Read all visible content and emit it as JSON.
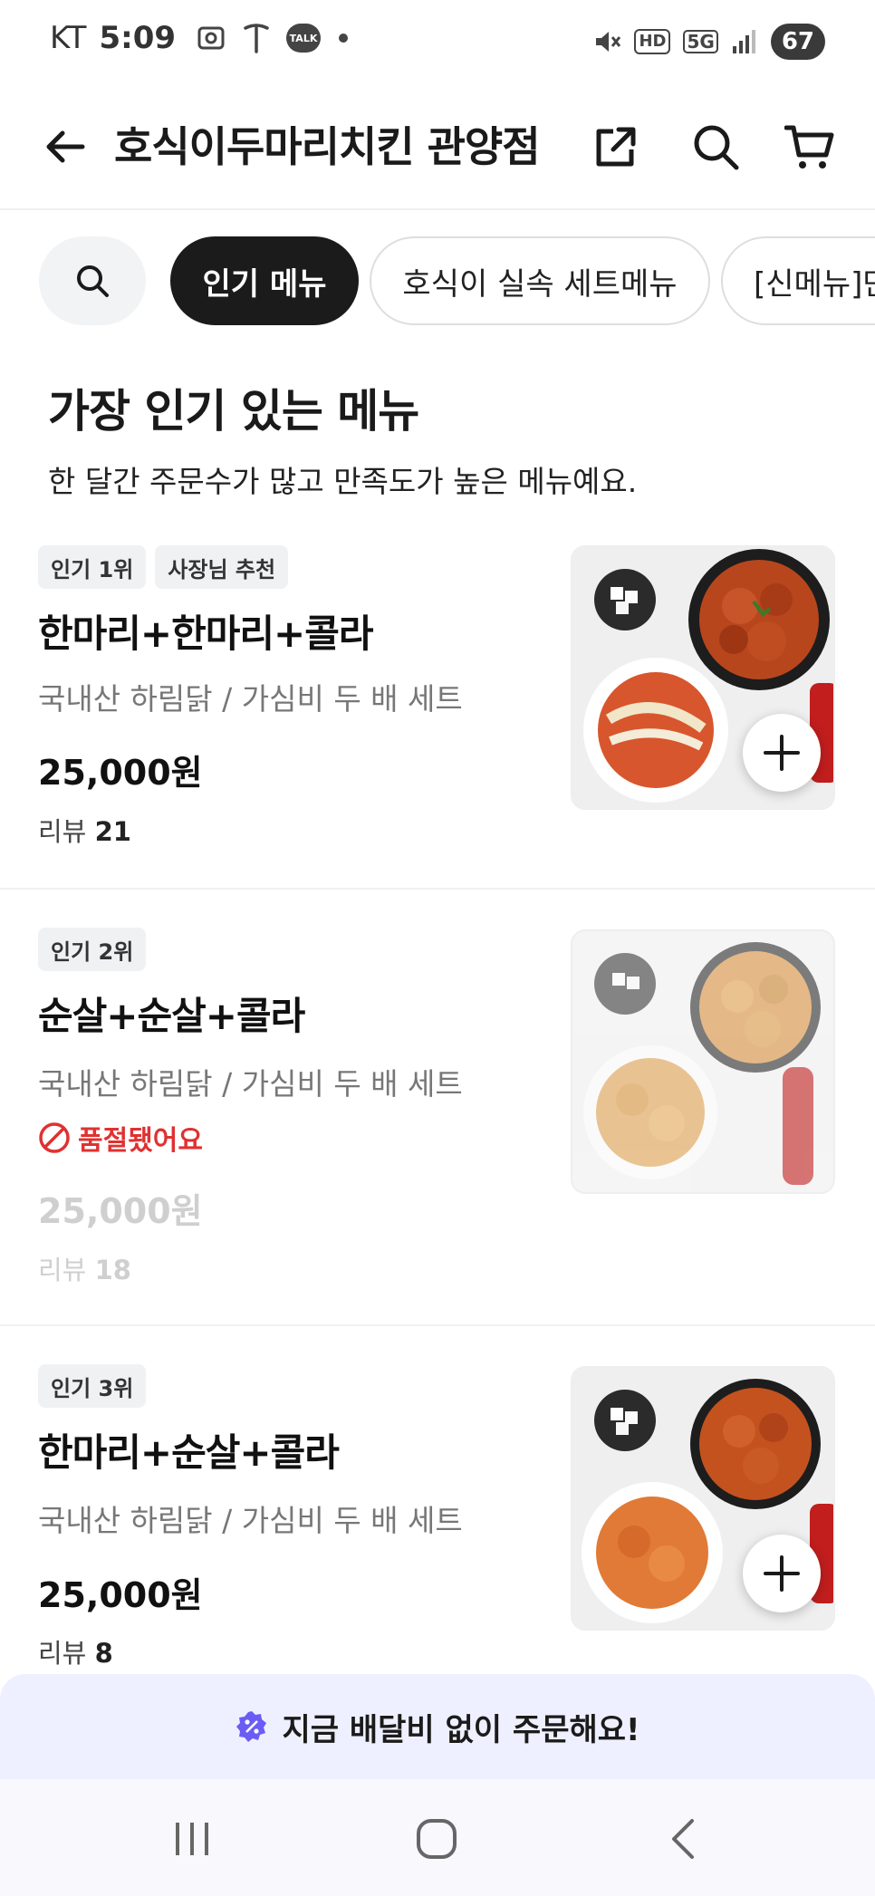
{
  "status_bar": {
    "carrier": "KT",
    "time": "5:09",
    "battery": "67",
    "network": "5G",
    "hd": "HD",
    "talk": "TALK"
  },
  "header": {
    "title": "호식이두마리치킨 관양점"
  },
  "categories": [
    {
      "label": "인기 메뉴",
      "active": true
    },
    {
      "label": "호식이 실속 세트메뉴",
      "active": false
    },
    {
      "label": "[신메뉴]만",
      "active": false
    }
  ],
  "section": {
    "title": "가장 인기 있는 메뉴",
    "subtitle": "한 달간 주문수가 많고 만족도가 높은 메뉴예요."
  },
  "menu_items": [
    {
      "badges": [
        "인기 1위",
        "사장님 추천"
      ],
      "name": "한마리+한마리+콜라",
      "description": "국내산 하림닭 / 가심비 두 배 세트",
      "price": "25,000원",
      "review_label": "리뷰",
      "review_count": "21",
      "sold_out": false
    },
    {
      "badges": [
        "인기 2위"
      ],
      "name": "순살+순살+콜라",
      "description": "국내산 하림닭 / 가심비 두 배 세트",
      "sold_out_text": "품절됐어요",
      "price": "25,000원",
      "review_label": "리뷰",
      "review_count": "18",
      "sold_out": true
    },
    {
      "badges": [
        "인기 3위"
      ],
      "name": "한마리+순살+콜라",
      "description": "국내산 하림닭 / 가심비 두 배 세트",
      "price": "25,000원",
      "review_label": "리뷰",
      "review_count": "8",
      "sold_out": false
    }
  ],
  "promo": {
    "text": "지금 배달비 없이 주문해요!"
  },
  "colors": {
    "accent": "#1b1b1b",
    "soldout": "#e03131",
    "promo_bg": "#eef0ff",
    "promo_icon": "#6a5cf5"
  },
  "icons": [
    "back-arrow-icon",
    "share-icon",
    "search-icon",
    "cart-icon",
    "plus-icon",
    "prohibit-icon",
    "discount-badge-icon",
    "recent-apps-icon",
    "home-icon",
    "nav-back-icon"
  ]
}
